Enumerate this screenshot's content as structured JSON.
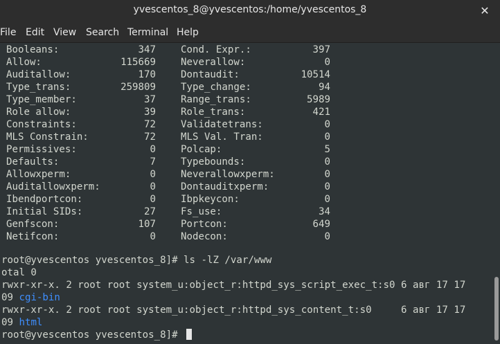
{
  "window": {
    "title": "yvescentos_8@yvescentos:/home/yvescentos_8"
  },
  "menu": [
    "File",
    "Edit",
    "View",
    "Search",
    "Terminal",
    "Help"
  ],
  "stats": [
    {
      "l_label": "Booleans:",
      "l_value": "347",
      "r_label": "Cond. Expr.:",
      "r_value": "397"
    },
    {
      "l_label": "Allow:",
      "l_value": "115669",
      "r_label": "Neverallow:",
      "r_value": "0"
    },
    {
      "l_label": "Auditallow:",
      "l_value": "170",
      "r_label": "Dontaudit:",
      "r_value": "10514"
    },
    {
      "l_label": "Type_trans:",
      "l_value": "259809",
      "r_label": "Type_change:",
      "r_value": "94"
    },
    {
      "l_label": "Type_member:",
      "l_value": "37",
      "r_label": "Range_trans:",
      "r_value": "5989"
    },
    {
      "l_label": "Role allow:",
      "l_value": "39",
      "r_label": "Role_trans:",
      "r_value": "421"
    },
    {
      "l_label": "Constraints:",
      "l_value": "72",
      "r_label": "Validatetrans:",
      "r_value": "0"
    },
    {
      "l_label": "MLS Constrain:",
      "l_value": "72",
      "r_label": "MLS Val. Tran:",
      "r_value": "0"
    },
    {
      "l_label": "Permissives:",
      "l_value": "0",
      "r_label": "Polcap:",
      "r_value": "5"
    },
    {
      "l_label": "Defaults:",
      "l_value": "7",
      "r_label": "Typebounds:",
      "r_value": "0"
    },
    {
      "l_label": "Allowxperm:",
      "l_value": "0",
      "r_label": "Neverallowxperm:",
      "r_value": "0"
    },
    {
      "l_label": "Auditallowxperm:",
      "l_value": "0",
      "r_label": "Dontauditxperm:",
      "r_value": "0"
    },
    {
      "l_label": "Ibendportcon:",
      "l_value": "0",
      "r_label": "Ibpkeycon:",
      "r_value": "0"
    },
    {
      "l_label": "Initial SIDs:",
      "l_value": "27",
      "r_label": "Fs_use:",
      "r_value": "34"
    },
    {
      "l_label": "Genfscon:",
      "l_value": "107",
      "r_label": "Portcon:",
      "r_value": "649"
    },
    {
      "l_label": "Netifcon:",
      "l_value": "0",
      "r_label": "Nodecon:",
      "r_value": "0"
    }
  ],
  "output": {
    "prompt1": "root@yvescentos yvescentos_8]# ls -lZ /var/www",
    "total": "otal 0",
    "line1": "rwxr-xr-x. 2 root root system_u:object_r:httpd_sys_script_exec_t:s0 6 авг 17 17",
    "line1_time": "09 ",
    "line1_name": "cgi-bin",
    "line2": "rwxr-xr-x. 2 root root system_u:object_r:httpd_sys_content_t:s0     6 авг 17 17",
    "line2_time": "09 ",
    "line2_name": "html",
    "prompt2": "root@yvescentos yvescentos_8]# "
  }
}
